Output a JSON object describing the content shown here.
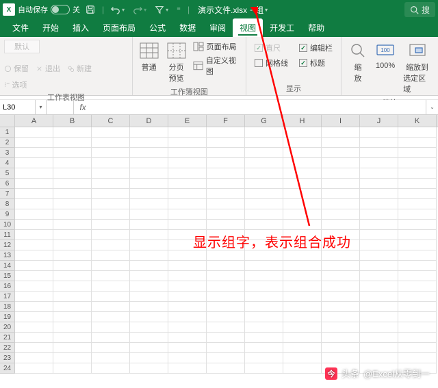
{
  "title_bar": {
    "autosave_label": "自动保存",
    "autosave_state": "关",
    "file_name": "演示文件.xlsx",
    "group_suffix": "组",
    "search_placeholder": "搜",
    "search_text": "搜"
  },
  "tabs": [
    "文件",
    "开始",
    "插入",
    "页面布局",
    "公式",
    "数据",
    "审阅",
    "视图",
    "开发工",
    "帮助"
  ],
  "active_tab": "视图",
  "ribbon": {
    "workbook_views": {
      "gallery_label": "默认",
      "keep": "保留",
      "exit": "退出",
      "new": "新建",
      "options": "选项",
      "group_label": "工作表视图"
    },
    "views": {
      "normal": "普通",
      "page_break": [
        "分页",
        "预览"
      ],
      "page_layout": "页面布局",
      "custom_views": "自定义视图",
      "group_label": "工作簿视图"
    },
    "show": {
      "ruler": "直尺",
      "formula_bar": "编辑栏",
      "gridlines": "网格线",
      "headings": "标题",
      "group_label": "显示"
    },
    "zoom": {
      "zoom": [
        "缩",
        "放"
      ],
      "hundred": "100%",
      "to_selection": [
        "缩放到",
        "选定区域"
      ],
      "group_label": "缩放"
    }
  },
  "name_box": "L30",
  "columns": [
    "A",
    "B",
    "C",
    "D",
    "E",
    "F",
    "G",
    "H",
    "I",
    "J",
    "K"
  ],
  "row_count": 24,
  "annotation_text": "显示组字，表示组合成功",
  "watermark": {
    "prefix": "头条",
    "handle": "@Excel从零到一"
  }
}
